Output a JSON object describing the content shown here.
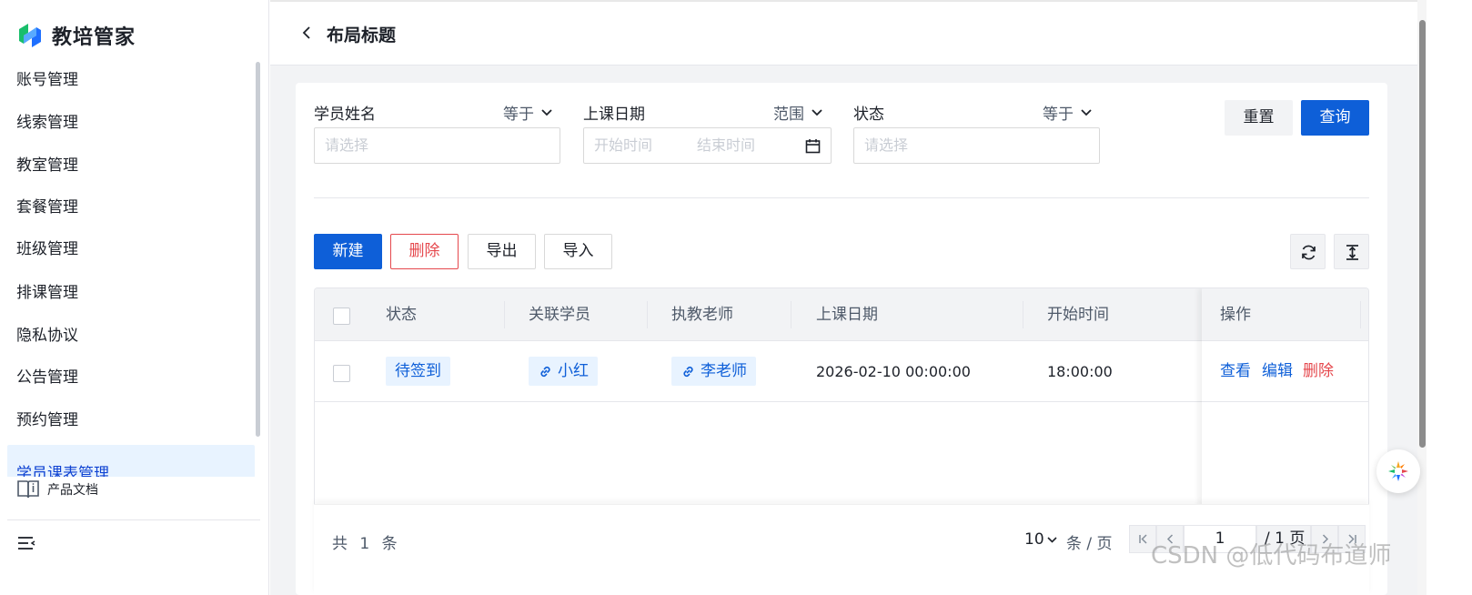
{
  "app": {
    "name": "教培管家"
  },
  "sidebar": {
    "items": [
      {
        "label": "账号管理"
      },
      {
        "label": "线索管理"
      },
      {
        "label": "教室管理"
      },
      {
        "label": "套餐管理"
      },
      {
        "label": "班级管理"
      },
      {
        "label": "排课管理"
      },
      {
        "label": "隐私协议"
      },
      {
        "label": "公告管理"
      },
      {
        "label": "预约管理"
      },
      {
        "label": "学员课表管理"
      }
    ],
    "doc_link": "产品文档",
    "brand_colors": {
      "green": "#19be6b",
      "blue": "#1e6fff"
    }
  },
  "header": {
    "title": "布局标题"
  },
  "filters": [
    {
      "label": "学员姓名",
      "operator": "等于",
      "placeholder": "请选择"
    },
    {
      "label": "上课日期",
      "operator": "范围",
      "start_placeholder": "开始时间",
      "end_placeholder": "结束时间"
    },
    {
      "label": "状态",
      "operator": "等于",
      "placeholder": "请选择"
    }
  ],
  "filter_actions": {
    "reset": "重置",
    "search": "查询"
  },
  "toolbar": {
    "new": "新建",
    "delete": "删除",
    "export": "导出",
    "import": "导入"
  },
  "table": {
    "columns": [
      "状态",
      "关联学员",
      "执教老师",
      "上课日期",
      "开始时间",
      "操作"
    ],
    "rows": [
      {
        "status": "待签到",
        "student": "小红",
        "teacher": "李老师",
        "date": "2026-02-10 00:00:00",
        "start_time": "18:00:00",
        "actions": {
          "view": "查看",
          "edit": "编辑",
          "delete": "删除"
        }
      }
    ]
  },
  "pagination": {
    "total_text": "共 1 条",
    "page_size": "10",
    "per_page_text": "条 / 页",
    "current_page": "1",
    "total_pages_text": "/ 1 页"
  },
  "watermark": "CSDN @低代码布道师",
  "colors": {
    "primary": "#0e5fd8",
    "danger": "#e5484d",
    "tag_bg": "#e8f3ff"
  }
}
